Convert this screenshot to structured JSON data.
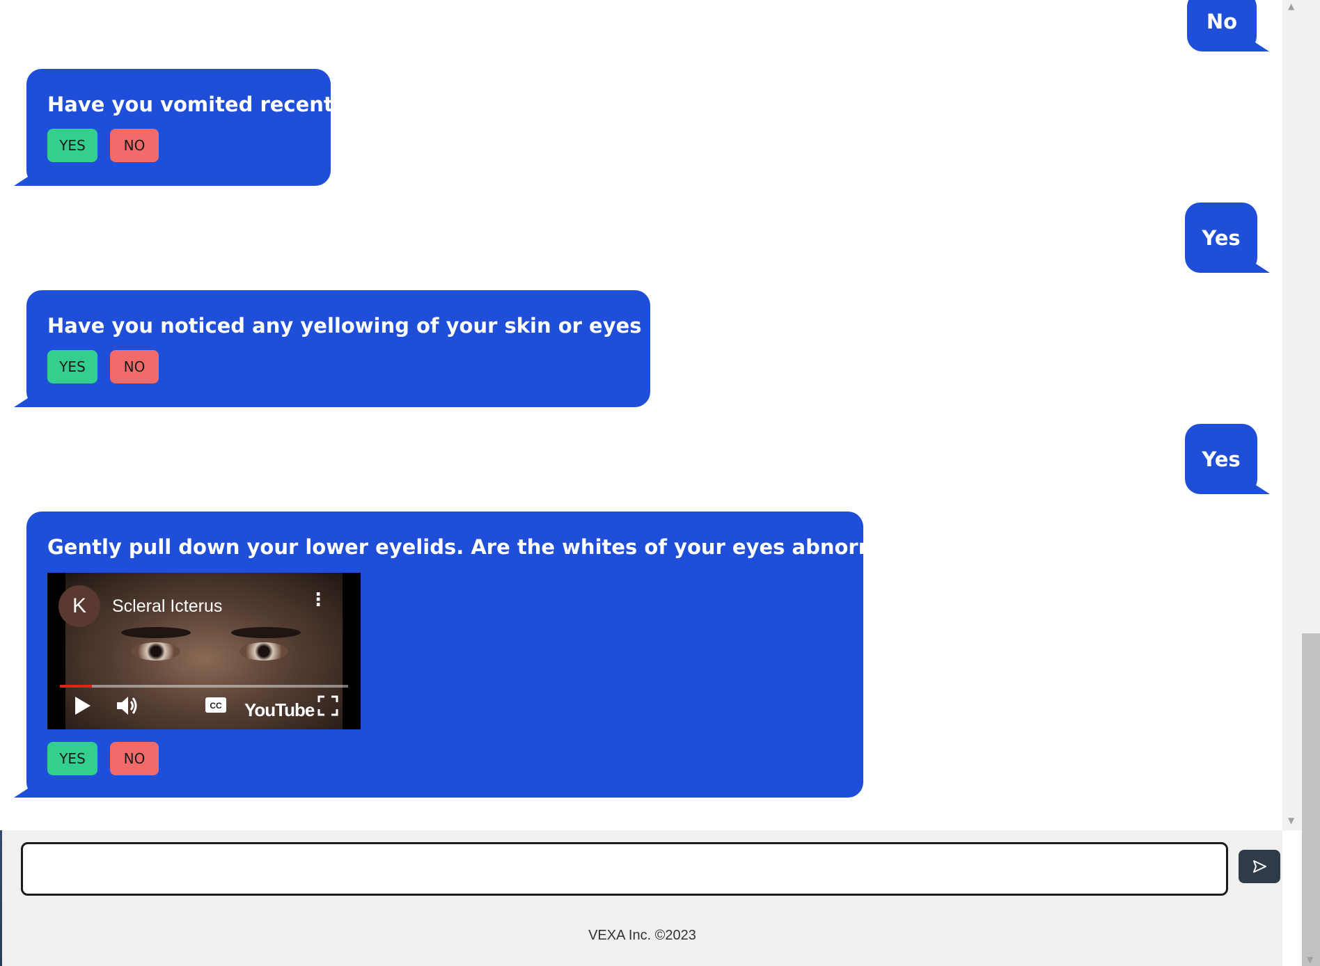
{
  "messages": {
    "user_1": "No",
    "bot_1": {
      "question": "Have you vomited recently?",
      "yes": "YES",
      "no": "NO"
    },
    "user_2": "Yes",
    "bot_2": {
      "question": "Have you noticed any yellowing of your skin or eyes recently?",
      "yes": "YES",
      "no": "NO"
    },
    "user_3": "Yes",
    "bot_3": {
      "question": "Gently pull down your lower eyelids. Are the whites of your eyes abnormally yellow?",
      "video": {
        "channel_initial": "K",
        "title": "Scleral Icterus",
        "brand": "YouTube",
        "cc_label": "CC",
        "progress": 0.11
      },
      "yes": "YES",
      "no": "NO"
    }
  },
  "composer": {
    "input_value": "",
    "send_icon": "send-arrow-icon"
  },
  "footer": {
    "text": "VEXA Inc. ©2023"
  },
  "colors": {
    "bubble": "#1f4fd8",
    "yes_button": "#34cf8e",
    "no_button": "#f26b6b",
    "send_button": "#2f3b48"
  }
}
